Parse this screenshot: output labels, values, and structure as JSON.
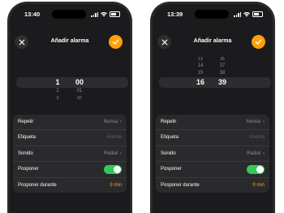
{
  "screens": [
    {
      "status_time": "13:40",
      "title": "Añadir alarma",
      "picker": {
        "hours": [
          "1",
          "2",
          "3"
        ],
        "minutes": [
          "00",
          "01",
          "02"
        ],
        "selected_index": 0
      },
      "rows": [
        {
          "label": "Repetir",
          "value": "Nunca"
        },
        {
          "label": "Etiqueta",
          "value": "Alarma"
        },
        {
          "label": "Sonido",
          "value": "Radial"
        },
        {
          "label": "Posponer",
          "toggle_on": true
        },
        {
          "label": "Posponer durante",
          "value": "9 min"
        }
      ]
    },
    {
      "status_time": "13:39",
      "title": "Añadir alarma",
      "picker": {
        "hours": [
          "13",
          "14",
          "15",
          "16"
        ],
        "minutes": [
          "36",
          "37",
          "38",
          "39"
        ],
        "selected_index": 3
      },
      "rows": [
        {
          "label": "Repetir",
          "value": "Nunca"
        },
        {
          "label": "Etiqueta",
          "value": "Alarma"
        },
        {
          "label": "Sonido",
          "value": "Radial"
        },
        {
          "label": "Posponer",
          "toggle_on": true
        },
        {
          "label": "Posponer durante",
          "value": "9 min"
        }
      ]
    }
  ],
  "icons": {
    "close": "close-icon",
    "confirm": "checkmark-icon",
    "chevron": "chevron-right-icon"
  },
  "colors": {
    "accent": "#ff9f0a",
    "toggle_on": "#34c759",
    "background": "#1b1b1d",
    "card": "#2a2a2c"
  }
}
